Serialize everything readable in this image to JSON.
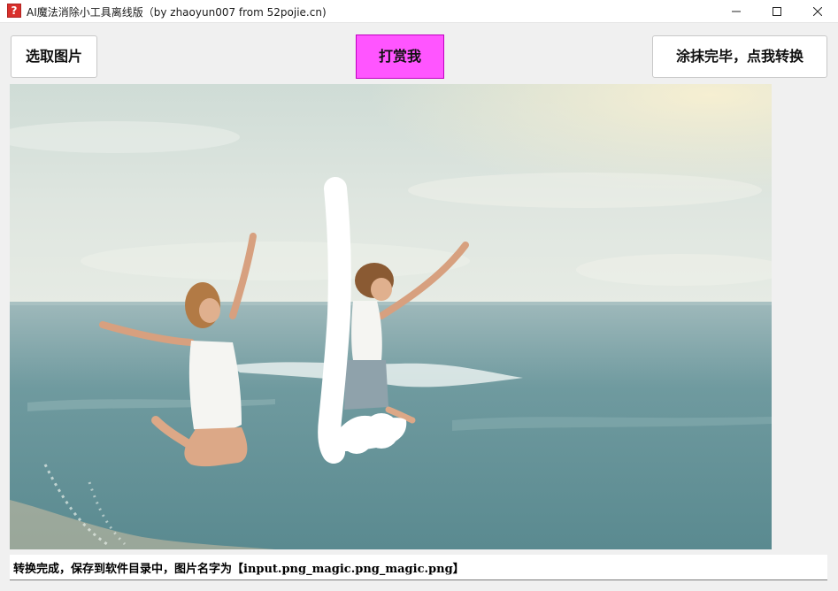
{
  "window": {
    "title": "AI魔法消除小工具离线版（by zhaoyun007 from 52pojie.cn)",
    "icon": "question-mark-icon"
  },
  "toolbar": {
    "select_image_label": "选取图片",
    "reward_label": "打赏我",
    "convert_label": "涂抹完毕，点我转换",
    "reward_color": "#ff55ff"
  },
  "canvas": {
    "image": "beach-photo-two-women-jumping",
    "mask_color": "#ffffff"
  },
  "status": {
    "text": "转换完成，保存到软件目录中，图片名字为【input.png_magic.png_magic.png】"
  }
}
